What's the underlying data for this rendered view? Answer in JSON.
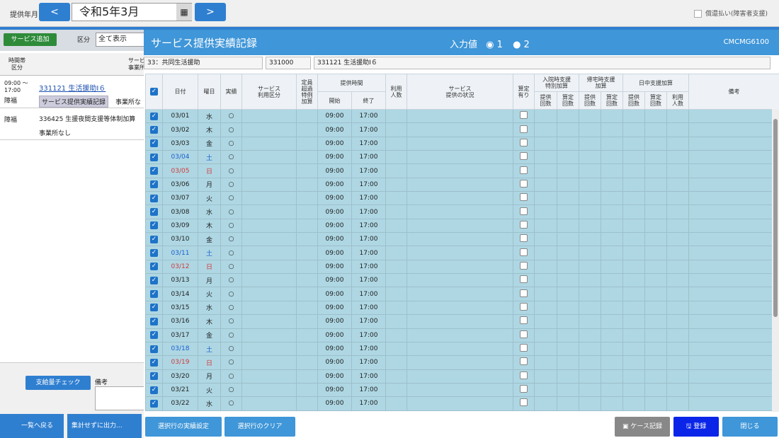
{
  "header": {
    "label": "提供年月",
    "prev": "<",
    "month": "令和5年3月",
    "next": ">",
    "pay_label": "償還払い(障害者支援)"
  },
  "left": {
    "add_button": "サービス追加",
    "kubun_label": "区分",
    "kubun_value": "全て表示",
    "head_time": "時間帯",
    "head_kubun": "区分",
    "head_service": "サービ",
    "head_office": "事業所",
    "rows": [
      {
        "time1": "09:00 〜",
        "time2": "17:00",
        "kubun": "障福",
        "service": "331121 生活援助Ⅰ６",
        "chip": "サービス提供実績記録",
        "office": "事業所な"
      },
      {
        "time1": "",
        "time2": "",
        "kubun": "障福",
        "service": "336425 生援夜間支援等体制加算",
        "chip": "",
        "office": "事業所なし"
      }
    ],
    "shikyu_button": "支給量チェック",
    "bikou_label": "備考",
    "back_button": "一覧へ戻る",
    "shukei_button": "集計せずに出力..."
  },
  "modal": {
    "title": "サービス提供実績記録",
    "input_label": "入力値",
    "opt1": "1",
    "opt2": "2",
    "code": "CMCMG6100",
    "info1": "33：共同生活援助",
    "info2": "331000",
    "info3": "331121 生活援助Ⅰ６",
    "columns": {
      "date": "日付",
      "dow": "曜日",
      "jisseki": "実績",
      "service_kubun1": "サービス",
      "service_kubun2": "利用区分",
      "teiin1": "定員",
      "teiin2": "超過",
      "teiin3": "特例",
      "teiin4": "加算",
      "time": "提供時間",
      "start": "開始",
      "end": "終了",
      "riyo1": "利用",
      "riyo2": "人数",
      "jokyo1": "サービス",
      "jokyo2": "提供の状況",
      "santei1": "算定",
      "santei2": "有り",
      "nyuin1": "入院時支援",
      "nyuin2": "特別加算",
      "kitaku1": "帰宅時支援",
      "kitaku2": "加算",
      "nicchu": "日中支援加算",
      "teikyo1": "提供",
      "teikyo2": "回数",
      "santei_k1": "算定",
      "santei_k2": "回数",
      "riyo_n1": "利用",
      "riyo_n2": "人数",
      "bikou": "備考"
    },
    "rows": [
      {
        "date": "03/01",
        "dow": "水",
        "type": "wd",
        "jisseki": "○",
        "start": "09:00",
        "end": "17:00"
      },
      {
        "date": "03/02",
        "dow": "木",
        "type": "wd",
        "jisseki": "○",
        "start": "09:00",
        "end": "17:00"
      },
      {
        "date": "03/03",
        "dow": "金",
        "type": "wd",
        "jisseki": "○",
        "start": "09:00",
        "end": "17:00"
      },
      {
        "date": "03/04",
        "dow": "土",
        "type": "sat",
        "jisseki": "○",
        "start": "09:00",
        "end": "17:00"
      },
      {
        "date": "03/05",
        "dow": "日",
        "type": "sun",
        "jisseki": "○",
        "start": "09:00",
        "end": "17:00"
      },
      {
        "date": "03/06",
        "dow": "月",
        "type": "wd",
        "jisseki": "○",
        "start": "09:00",
        "end": "17:00"
      },
      {
        "date": "03/07",
        "dow": "火",
        "type": "wd",
        "jisseki": "○",
        "start": "09:00",
        "end": "17:00"
      },
      {
        "date": "03/08",
        "dow": "水",
        "type": "wd",
        "jisseki": "○",
        "start": "09:00",
        "end": "17:00"
      },
      {
        "date": "03/09",
        "dow": "木",
        "type": "wd",
        "jisseki": "○",
        "start": "09:00",
        "end": "17:00"
      },
      {
        "date": "03/10",
        "dow": "金",
        "type": "wd",
        "jisseki": "○",
        "start": "09:00",
        "end": "17:00"
      },
      {
        "date": "03/11",
        "dow": "土",
        "type": "sat",
        "jisseki": "○",
        "start": "09:00",
        "end": "17:00"
      },
      {
        "date": "03/12",
        "dow": "日",
        "type": "sun",
        "jisseki": "○",
        "start": "09:00",
        "end": "17:00"
      },
      {
        "date": "03/13",
        "dow": "月",
        "type": "wd",
        "jisseki": "○",
        "start": "09:00",
        "end": "17:00"
      },
      {
        "date": "03/14",
        "dow": "火",
        "type": "wd",
        "jisseki": "○",
        "start": "09:00",
        "end": "17:00"
      },
      {
        "date": "03/15",
        "dow": "水",
        "type": "wd",
        "jisseki": "○",
        "start": "09:00",
        "end": "17:00"
      },
      {
        "date": "03/16",
        "dow": "木",
        "type": "wd",
        "jisseki": "○",
        "start": "09:00",
        "end": "17:00"
      },
      {
        "date": "03/17",
        "dow": "金",
        "type": "wd",
        "jisseki": "○",
        "start": "09:00",
        "end": "17:00"
      },
      {
        "date": "03/18",
        "dow": "土",
        "type": "sat",
        "jisseki": "○",
        "start": "09:00",
        "end": "17:00"
      },
      {
        "date": "03/19",
        "dow": "日",
        "type": "sun",
        "jisseki": "○",
        "start": "09:00",
        "end": "17:00"
      },
      {
        "date": "03/20",
        "dow": "月",
        "type": "wd",
        "jisseki": "○",
        "start": "09:00",
        "end": "17:00"
      },
      {
        "date": "03/21",
        "dow": "火",
        "type": "wd",
        "jisseki": "○",
        "start": "09:00",
        "end": "17:00"
      },
      {
        "date": "03/22",
        "dow": "水",
        "type": "wd",
        "jisseki": "○",
        "start": "09:00",
        "end": "17:00"
      }
    ],
    "footer": {
      "set_button": "選択行の実績設定",
      "clear_button": "選択行のクリア",
      "case_button": "ケース記録",
      "register_button": "登録",
      "close_button": "閉じる"
    }
  }
}
